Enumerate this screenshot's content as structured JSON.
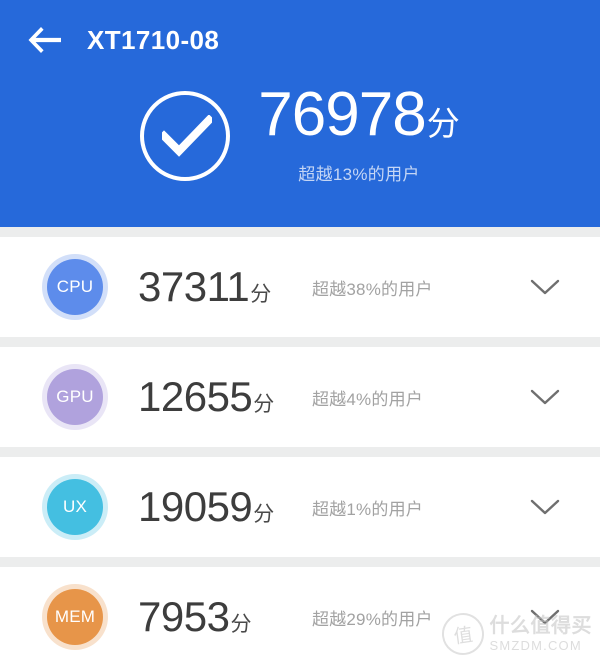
{
  "header": {
    "back_icon": "arrow-left-icon",
    "device_title": "XT1710-08",
    "background_color": "#2669da",
    "status_icon": "check-circle-icon",
    "total_score": "76978",
    "score_unit": "分",
    "score_subtitle": "超越13%的用户"
  },
  "metrics": [
    {
      "badge_label": "CPU",
      "badge_color": "#5d8ceb",
      "value": "37311",
      "unit": "分",
      "subtitle": "超越38%的用户",
      "expand_icon": "chevron-down-icon"
    },
    {
      "badge_label": "GPU",
      "badge_color": "#b0a2dd",
      "value": "12655",
      "unit": "分",
      "subtitle": "超越4%的用户",
      "expand_icon": "chevron-down-icon"
    },
    {
      "badge_label": "UX",
      "badge_color": "#44bfe1",
      "value": "19059",
      "unit": "分",
      "subtitle": "超越1%的用户",
      "expand_icon": "chevron-down-icon"
    },
    {
      "badge_label": "MEM",
      "badge_color": "#e79549",
      "value": "7953",
      "unit": "分",
      "subtitle": "超越29%的用户",
      "expand_icon": "chevron-down-icon"
    }
  ],
  "watermark": {
    "logo_glyph": "值",
    "name_cn": "什么值得买",
    "name_en": "SMZDM.COM"
  }
}
